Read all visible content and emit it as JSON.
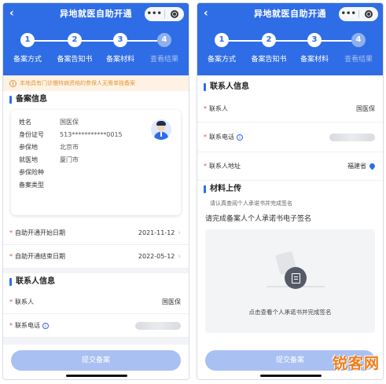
{
  "app": {
    "title": "异地就医自助开通",
    "back_glyph": "‹",
    "menu_dots": "•••"
  },
  "steps": [
    {
      "num": "1",
      "label": "备案方式"
    },
    {
      "num": "2",
      "label": "备案告知书"
    },
    {
      "num": "3",
      "label": "备案材料"
    },
    {
      "num": "4",
      "label": "查看结果"
    }
  ],
  "left": {
    "notice": "本地具有门诊慢特病资格的参保人无需单独备案",
    "filing_info_title": "备案信息",
    "info_rows": [
      {
        "key": "姓名",
        "value": "国医保"
      },
      {
        "key": "身份证号",
        "value": "513***********0015"
      },
      {
        "key": "参保地",
        "value": "北京市"
      },
      {
        "key": "就医地",
        "value": "厦门市"
      },
      {
        "key": "参保险种",
        "value": ""
      },
      {
        "key": "备案类型",
        "value": ""
      }
    ],
    "start_date_label": "自助开通开始日期",
    "start_date_value": "2021-11-12",
    "end_date_label": "自助开通结束日期",
    "end_date_value": "2022-05-12",
    "contact_title": "联系人信息",
    "contact_label": "联系人",
    "contact_value": "国医保",
    "phone_label": "联系电话",
    "submit_label": "提交备案"
  },
  "right": {
    "contact_title": "联系人信息",
    "contact_label": "联系人",
    "contact_value": "国医保",
    "phone_label": "联系电话",
    "address_label": "联系人地址",
    "address_value": "福建省",
    "materials_title": "材料上传",
    "materials_hint": "请认真查阅个人承诺书并完成签名",
    "sign_title": "请完成备案人个人承诺书电子签名",
    "sign_text": "点击查看个人承诺书并完成签名",
    "submit_label": "提交备案"
  },
  "watermark": "锐客网",
  "colors": {
    "primary": "#2f6de6",
    "required_star": "#e94b3c",
    "notice_text": "#e39a3b",
    "button_disabled": "#a9c0f2"
  },
  "icons": [
    "back-icon",
    "more-dots-icon",
    "capsule-target-icon",
    "warning-icon",
    "avatar-icon",
    "chevron-right-icon",
    "info-icon",
    "location-pin-icon",
    "sign-document-icon"
  ]
}
